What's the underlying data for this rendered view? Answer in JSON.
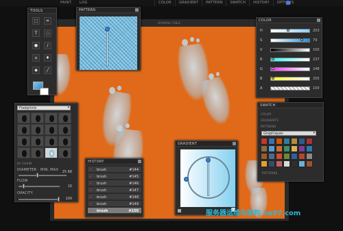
{
  "topbar": {
    "left_items": [
      "PAINT",
      "LOG"
    ],
    "menu": [
      "COLOR",
      "GRADIENT",
      "PATTERN",
      "SWATCH",
      "HISTORY",
      "OPTIONS"
    ],
    "menu_icon": "flag-icon"
  },
  "canvas": {
    "title": "DRAWING TABLE",
    "color": "#e06a1a"
  },
  "tools": {
    "title": "TOOLS",
    "items": [
      "select-icon",
      "crop-icon",
      "text-icon",
      "lasso-icon",
      "brush-icon",
      "pencil-icon",
      "fill-icon",
      "eyedropper-icon",
      "eraser-icon",
      "line-icon"
    ]
  },
  "pattern": {
    "title": "PATTERN"
  },
  "color": {
    "title": "COLOR",
    "rows": [
      {
        "label": "H",
        "value": "203"
      },
      {
        "label": "S",
        "value": "79"
      },
      {
        "label": "V",
        "value": "100"
      },
      {
        "label": "R",
        "value": "237"
      },
      {
        "label": "G",
        "value": "248"
      },
      {
        "label": "B",
        "value": "255"
      },
      {
        "label": "A",
        "value": "100"
      }
    ]
  },
  "swatch": {
    "title": "SWATCH",
    "tabs": [
      "COLOR",
      "GRADIENTS",
      "PATTERNS"
    ],
    "dropdown": "Graphiques",
    "footer": "PATTERNS"
  },
  "brush": {
    "title": "Footprints",
    "label_row": "BY CHAIN",
    "diameter_label": "DIAMETER · MIN, MAX",
    "diameter_value": "25 68",
    "flow_label": "FLOW",
    "flow_value": "10",
    "opacity_label": "OPACITY",
    "opacity_value": "100"
  },
  "history": {
    "title": "HISTORY",
    "rows": [
      {
        "name": "brush",
        "id": "#144"
      },
      {
        "name": "brush",
        "id": "#145"
      },
      {
        "name": "brush",
        "id": "#146"
      },
      {
        "name": "brush",
        "id": "#147"
      },
      {
        "name": "brush",
        "id": "#148"
      },
      {
        "name": "brush",
        "id": "#149"
      },
      {
        "name": "brush",
        "id": "#150"
      }
    ]
  },
  "gradient": {
    "title": "GRADIENT"
  },
  "watermark": "服务器运维与架构 ha97.com"
}
